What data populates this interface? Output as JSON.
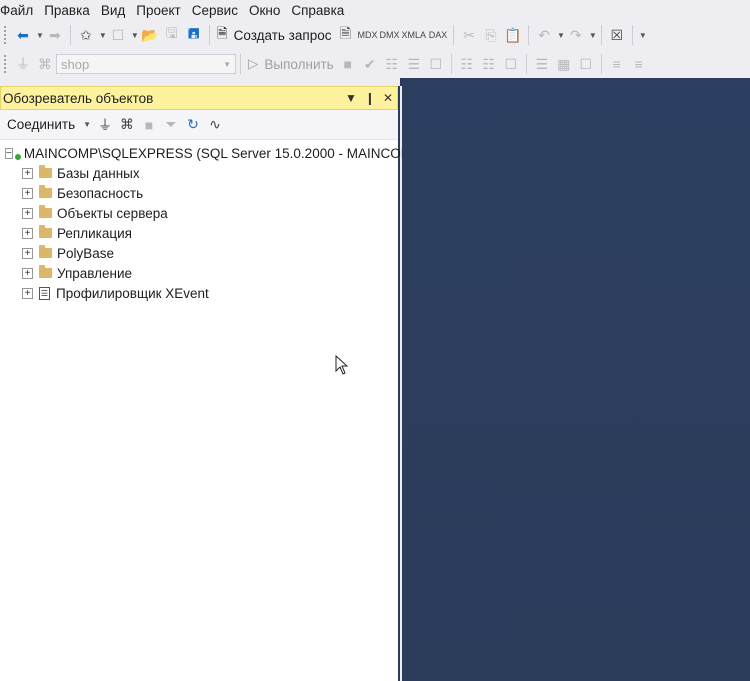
{
  "menu": [
    "Файл",
    "Правка",
    "Вид",
    "Проект",
    "Сервис",
    "Окно",
    "Справка"
  ],
  "toolbar1": {
    "new_query_label": "Создать запрос",
    "query_types": [
      "MDX",
      "DMX",
      "XMLA",
      "DAX"
    ]
  },
  "toolbar2": {
    "database_combo": "shop",
    "execute_label": "Выполнить"
  },
  "object_explorer": {
    "title": "Обозреватель объектов",
    "connect_label": "Соединить",
    "server_node": "MAINCOMP\\SQLEXPRESS (SQL Server 15.0.2000 - MAINCOM",
    "children": [
      {
        "label": "Базы данных",
        "icon": "folder-icon"
      },
      {
        "label": "Безопасность",
        "icon": "folder-icon"
      },
      {
        "label": "Объекты сервера",
        "icon": "folder-icon"
      },
      {
        "label": "Репликация",
        "icon": "folder-icon"
      },
      {
        "label": "PolyBase",
        "icon": "folder-icon"
      },
      {
        "label": "Управление",
        "icon": "folder-icon"
      },
      {
        "label": "Профилировщик XEvent",
        "icon": "xevent-icon"
      }
    ]
  },
  "colors": {
    "title_bar": "#fef29e",
    "document_area": "#2c3e5f",
    "chrome": "#eeeef2"
  }
}
